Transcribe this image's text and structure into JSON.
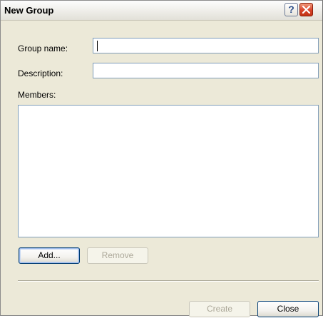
{
  "window": {
    "title": "New Group",
    "help_glyph": "?"
  },
  "form": {
    "group_name_label": "Group name:",
    "group_name_value": "",
    "description_label": "Description:",
    "description_value": "",
    "members_label": "Members:",
    "members": []
  },
  "buttons": {
    "add": "Add...",
    "remove": "Remove",
    "create": "Create",
    "close": "Close"
  },
  "icons": {
    "help": "help-icon",
    "close": "close-icon"
  },
  "colors": {
    "dialog_bg": "#ece9d8",
    "close_red": "#d8422a",
    "field_border": "#7f9db9",
    "disabled_text": "#aca899"
  }
}
